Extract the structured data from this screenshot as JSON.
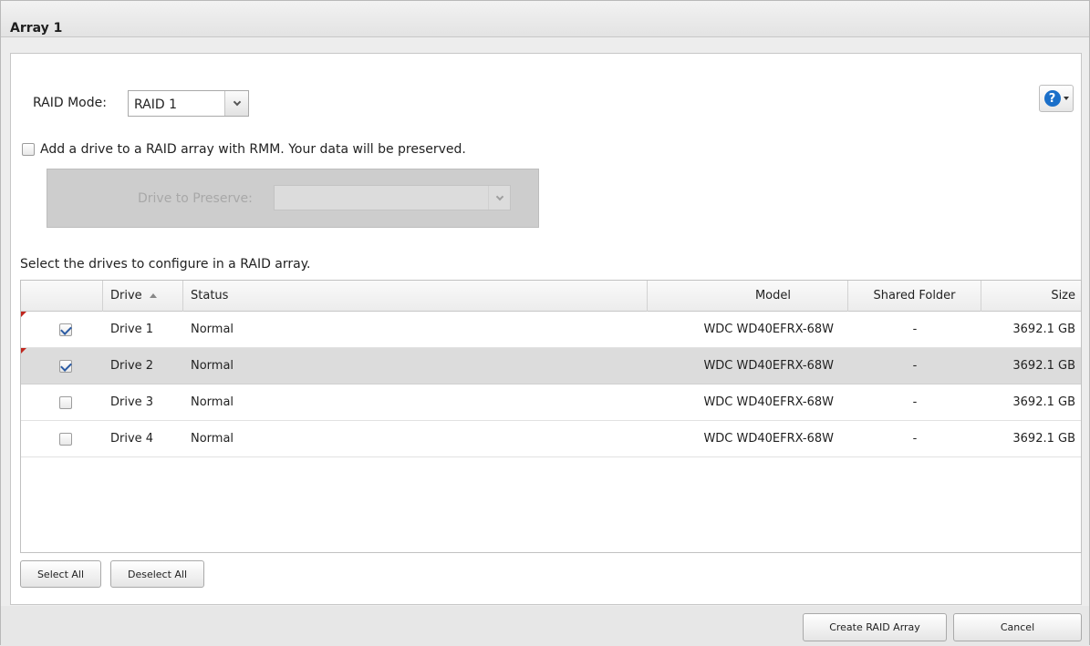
{
  "window": {
    "title": "Array 1"
  },
  "help": {
    "icon": "help-icon",
    "glyph": "?"
  },
  "raid_mode": {
    "label": "RAID Mode:",
    "value": "RAID 1"
  },
  "rmm": {
    "checkbox_label": "Add a drive to a RAID array with RMM. Your data will be preserved.",
    "checked": false
  },
  "preserve": {
    "label": "Drive to Preserve:",
    "value": ""
  },
  "drives_section": {
    "instruction": "Select the drives to configure in a RAID array."
  },
  "table": {
    "columns": {
      "drive": "Drive",
      "status": "Status",
      "model": "Model",
      "shared_folder": "Shared Folder",
      "size": "Size"
    },
    "rows": [
      {
        "checked": true,
        "drive": "Drive 1",
        "status": "Normal",
        "model": "WDC WD40EFRX-68W",
        "shared_folder": "-",
        "size": "3692.1 GB"
      },
      {
        "checked": true,
        "drive": "Drive 2",
        "status": "Normal",
        "model": "WDC WD40EFRX-68W",
        "shared_folder": "-",
        "size": "3692.1 GB"
      },
      {
        "checked": false,
        "drive": "Drive 3",
        "status": "Normal",
        "model": "WDC WD40EFRX-68W",
        "shared_folder": "-",
        "size": "3692.1 GB"
      },
      {
        "checked": false,
        "drive": "Drive 4",
        "status": "Normal",
        "model": "WDC WD40EFRX-68W",
        "shared_folder": "-",
        "size": "3692.1 GB"
      }
    ]
  },
  "buttons": {
    "select_all": "Select All",
    "deselect_all": "Deselect All",
    "create_raid": "Create RAID Array",
    "cancel": "Cancel"
  }
}
